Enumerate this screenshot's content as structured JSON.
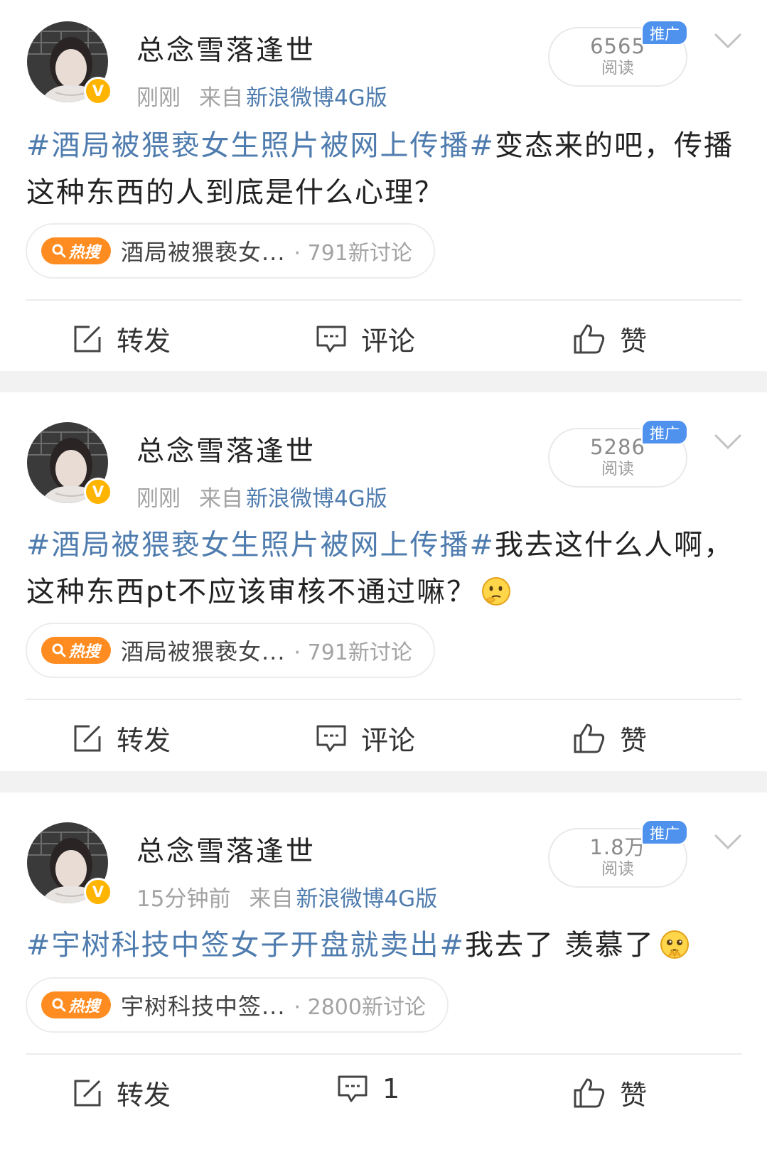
{
  "posts": [
    {
      "username": "总念雪落逢世",
      "verified_badge": "V",
      "time": "刚刚",
      "from_label": "来自",
      "client": "新浪微博4G版",
      "reads_count": "6565",
      "reads_label": "阅读",
      "promo_label": "推广",
      "hashtag": "#酒局被猥亵女生照片被网上传播#",
      "text": "变态来的吧，传播这种东西的人到底是什么心理？",
      "emoji": "",
      "hot_badge": "热搜",
      "hot_title": "酒局被猥亵女...",
      "hot_count": "· 791新讨论",
      "repost_label": "转发",
      "comment_label": "评论",
      "like_label": "赞"
    },
    {
      "username": "总念雪落逢世",
      "verified_badge": "V",
      "time": "刚刚",
      "from_label": "来自",
      "client": "新浪微博4G版",
      "reads_count": "5286",
      "reads_label": "阅读",
      "promo_label": "推广",
      "hashtag": "#酒局被猥亵女生照片被网上传播#",
      "text": "我去这什么人啊，这种东西pt不应该审核不通过嘛？",
      "emoji": "thinking-emoji",
      "hot_badge": "热搜",
      "hot_title": "酒局被猥亵女...",
      "hot_count": "· 791新讨论",
      "repost_label": "转发",
      "comment_label": "评论",
      "like_label": "赞"
    },
    {
      "username": "总念雪落逢世",
      "verified_badge": "V",
      "time": "15分钟前",
      "from_label": "来自",
      "client": "新浪微博4G版",
      "reads_count": "1.8万",
      "reads_label": "阅读",
      "promo_label": "推广",
      "hashtag": "#宇树科技中签女子开盘就卖出#",
      "text": "我去了 羡慕了",
      "emoji": "pleading-emoji",
      "hot_badge": "热搜",
      "hot_title": "宇树科技中签...",
      "hot_count": "· 2800新讨论",
      "repost_label": "转发",
      "comment_label": "1",
      "like_label": "赞"
    }
  ],
  "colors": {
    "link_blue": "#4f7cae",
    "hot_orange": "#ff8c21",
    "promo_blue": "#4e92ee",
    "verified_yellow": "#ffb400",
    "separator_gray": "#f2f2f2"
  },
  "icons": {
    "repost": "edit-square-icon",
    "comment": "comment-bubble-icon",
    "like": "thumbs-up-icon",
    "more": "chevron-down-icon",
    "search": "search-icon"
  }
}
